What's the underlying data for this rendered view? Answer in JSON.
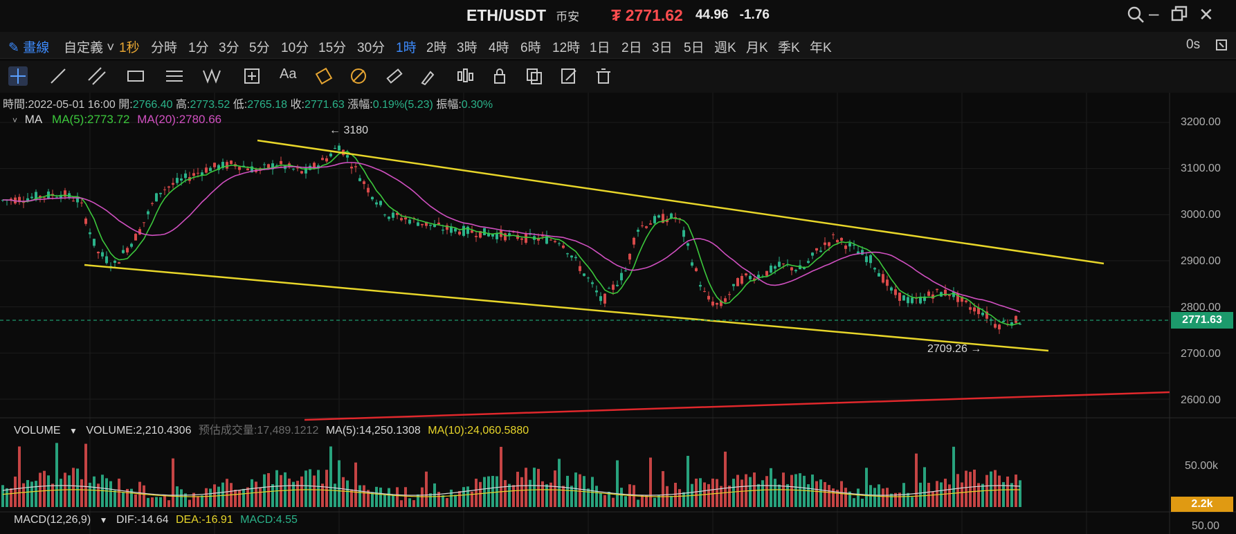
{
  "title": {
    "pair": "ETH/USDT",
    "exchange": "币安",
    "price": "₮ 2771.62",
    "change": "44.96",
    "change_pct": "-1.76"
  },
  "window_controls": {
    "search": "search-icon",
    "minimize": "–",
    "restore": "restore-icon",
    "close": "✕"
  },
  "timeframes": [
    {
      "label": "✎ 畫線"
    },
    {
      "label": "自定義 ˅"
    },
    {
      "label": "1秒"
    },
    {
      "label": "分時"
    },
    {
      "label": "1分"
    },
    {
      "label": "3分"
    },
    {
      "label": "5分"
    },
    {
      "label": "10分"
    },
    {
      "label": "15分"
    },
    {
      "label": "30分"
    },
    {
      "label": "1時"
    },
    {
      "label": "2時"
    },
    {
      "label": "3時"
    },
    {
      "label": "4時"
    },
    {
      "label": "6時"
    },
    {
      "label": "12時"
    },
    {
      "label": "1日"
    },
    {
      "label": "2日"
    },
    {
      "label": "3日"
    },
    {
      "label": "5日"
    },
    {
      "label": "週K"
    },
    {
      "label": "月K"
    },
    {
      "label": "季K"
    },
    {
      "label": "年K"
    }
  ],
  "countdown": "0s",
  "tools": [
    "crosshair-icon",
    "trendline-icon",
    "parallel-channel-icon",
    "rectangle-icon",
    "horizontal-lines-icon",
    "wave-icon",
    "measure-icon",
    "text-icon",
    "fib-icon",
    "fib-circle-icon",
    "ruler-icon",
    "brush-icon",
    "ohlc-icon",
    "lock-icon",
    "copy-icon",
    "edit-icon",
    "delete-icon"
  ],
  "tool_text": "Aa",
  "info": {
    "time_label": "時間:",
    "time": "2022-05-01 16:00",
    "open_label": "開:",
    "open": "2766.40",
    "high_label": "高:",
    "high": "2773.52",
    "low_label": "低:",
    "low": "2765.18",
    "close_label": "收:",
    "close": "2771.63",
    "chg_label": "漲幅:",
    "chg": "0.19%(5.23)",
    "amp_label": "振幅:",
    "amp": "0.30%"
  },
  "ma": {
    "name": "MA",
    "ma5": "MA(5):2773.72",
    "ma20": "MA(20):2780.66",
    "ma5_color": "#3cc83c",
    "ma20_color": "#d050c0"
  },
  "volume_info": {
    "name": "VOLUME",
    "volume": "VOLUME:2,210.4306",
    "estimate": "预估成交量:17,489.1212",
    "ma5": "MA(5):14,250.1308",
    "ma10": "MA(10):24,060.5880"
  },
  "macd_info": {
    "name": "MACD(12,26,9)",
    "dif": "DIF:-14.64",
    "dea": "DEA:-16.91",
    "macd": "MACD:4.55"
  },
  "price_axis": [
    "3200.00",
    "3100.00",
    "3000.00",
    "2900.00",
    "2800.00",
    "2700.00",
    "2600.00"
  ],
  "volume_axis": [
    "50.00k"
  ],
  "macd_axis": [
    "50.00"
  ],
  "current_price_tag": "2771.63",
  "volume_tag": "2.2k",
  "annotations": {
    "high": "3180",
    "low": "2709.26"
  },
  "colors": {
    "up": "#2bb38a",
    "down": "#d94a4a",
    "trend": "#e8d62a",
    "support": "#e0282c",
    "background": "#0b0b0b"
  }
}
